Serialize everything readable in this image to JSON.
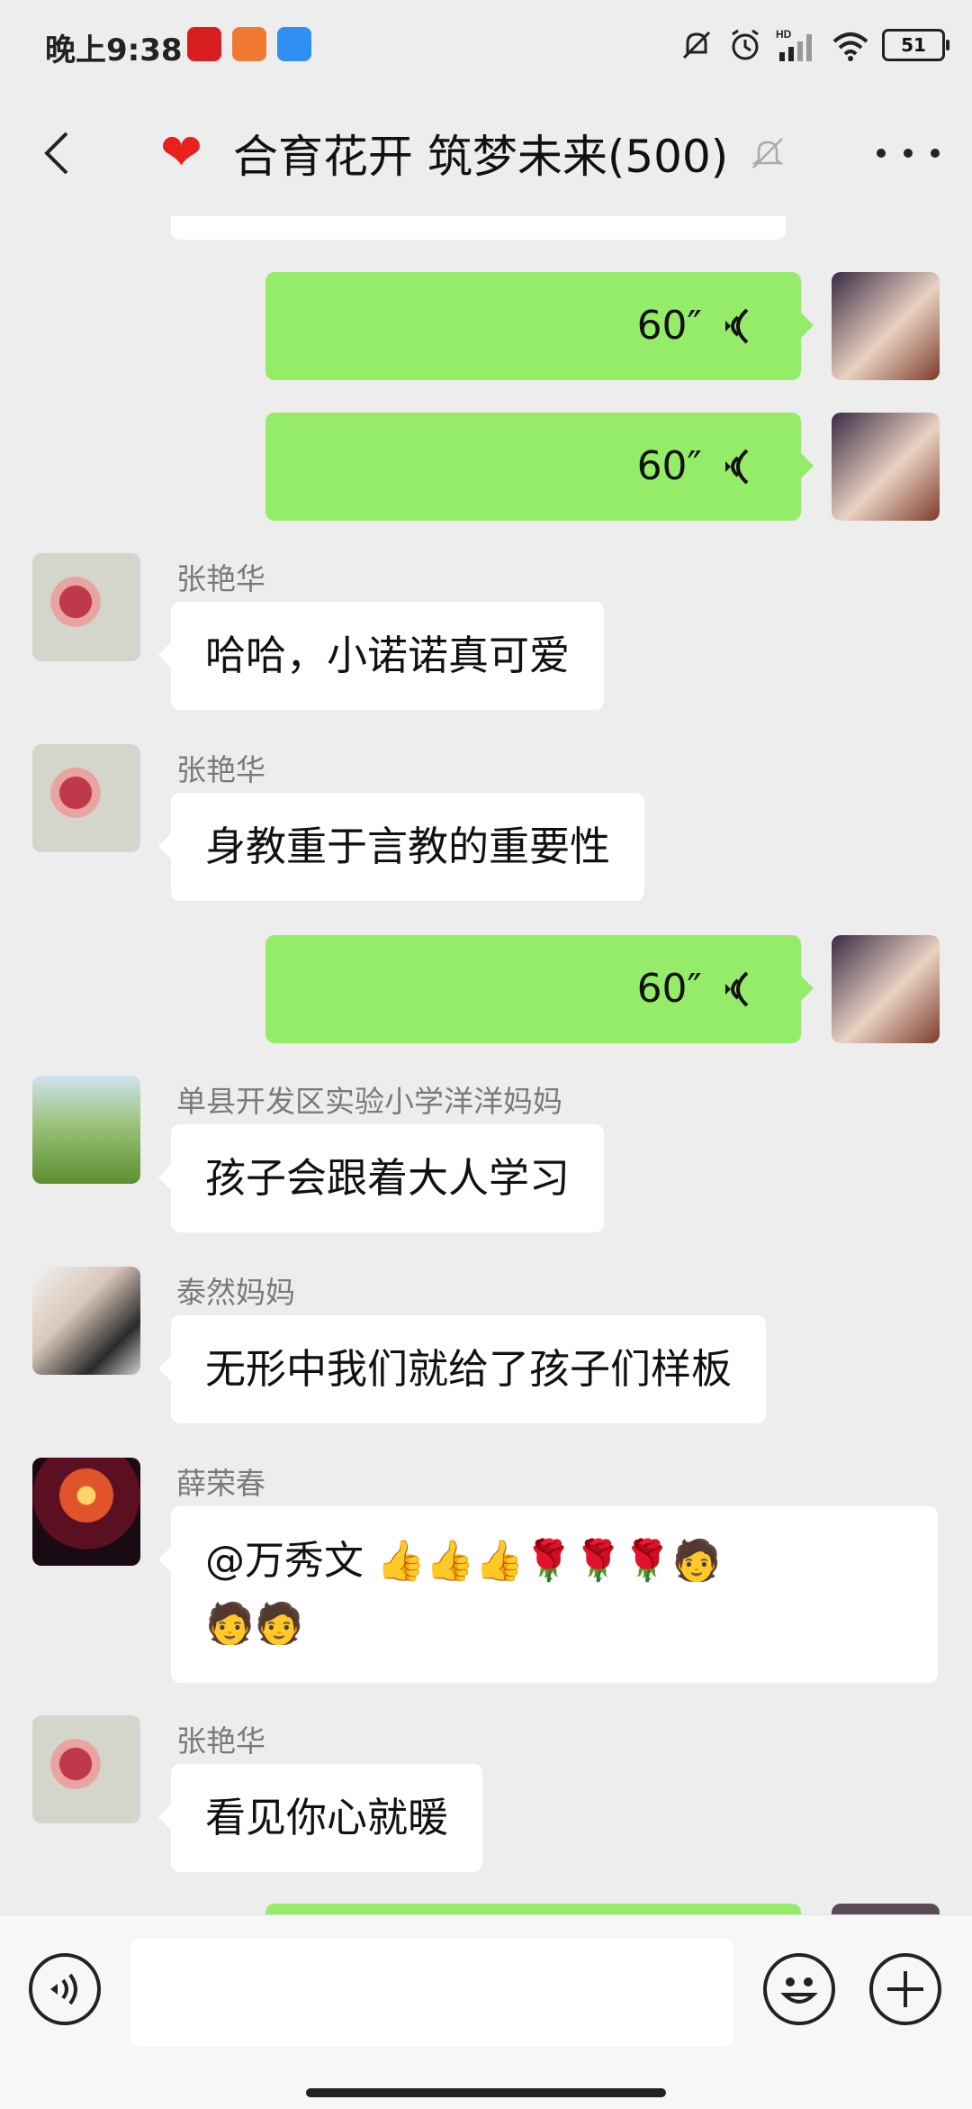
{
  "status_bar": {
    "time": "晚上9:38",
    "battery": "51",
    "signal_label": "HD"
  },
  "header": {
    "title": "合育花开 筑梦未来(500)",
    "heart_icon": "red-heart",
    "back_icon": "chevron-left-icon",
    "mute_icon": "bell-muted-icon",
    "more_icon": "more-dots-icon"
  },
  "messages": [
    {
      "type": "voice",
      "direction": "out",
      "duration": "60″"
    },
    {
      "type": "voice",
      "direction": "out",
      "duration": "60″"
    },
    {
      "type": "text",
      "direction": "in",
      "sender": "张艳华",
      "text": "哈哈，小诺诺真可爱"
    },
    {
      "type": "text",
      "direction": "in",
      "sender": "张艳华",
      "text": "身教重于言教的重要性"
    },
    {
      "type": "voice",
      "direction": "out",
      "duration": "60″"
    },
    {
      "type": "text",
      "direction": "in",
      "sender": "单县开发区实验小学洋洋妈妈",
      "text": "孩子会跟着大人学习"
    },
    {
      "type": "text",
      "direction": "in",
      "sender": "泰然妈妈",
      "text": "无形中我们就给了孩子们样板"
    },
    {
      "type": "text",
      "direction": "in",
      "sender": "薛荣春",
      "text_line1": "@万秀文 👍👍👍🌹🌹🌹🧑",
      "text_line2": "🧑🧑"
    },
    {
      "type": "text",
      "direction": "in",
      "sender": "张艳华",
      "text": "看见你心就暖"
    }
  ],
  "input_bar": {
    "voice_icon": "voice-mode-icon",
    "emoji_icon": "emoji-icon",
    "add_icon": "plus-icon",
    "input_value": ""
  },
  "colors": {
    "background": "#ededed",
    "outgoing_bubble": "#95ec69",
    "incoming_bubble": "#ffffff",
    "name_gray": "#7a7a7a"
  }
}
